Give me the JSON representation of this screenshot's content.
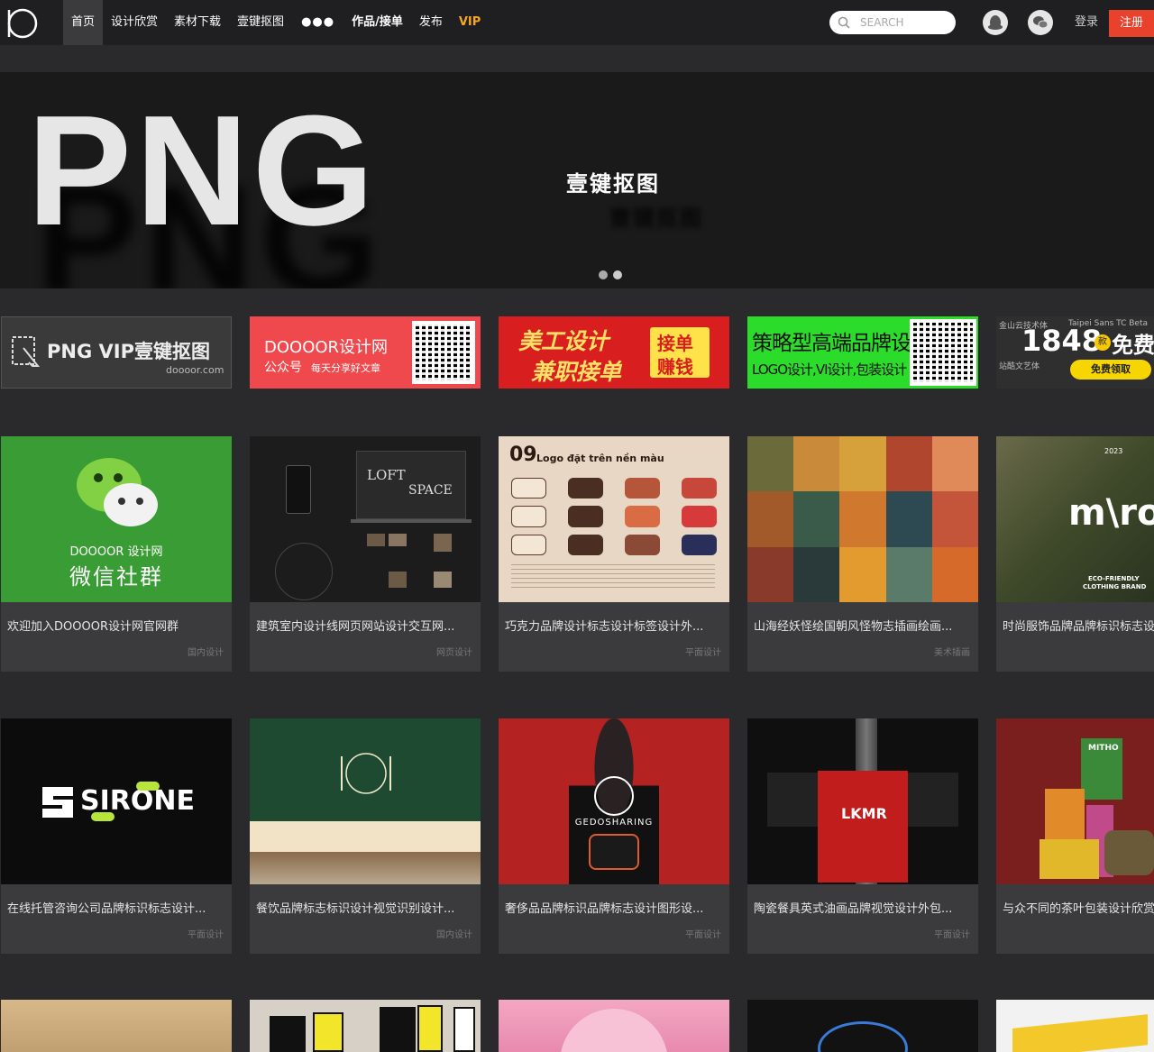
{
  "nav": {
    "items": [
      {
        "label": "首页",
        "active": true
      },
      {
        "label": "设计欣赏"
      },
      {
        "label": "素材下载"
      },
      {
        "label": "壹键抠图"
      },
      {
        "label": "●●●"
      },
      {
        "label": "作品/接单"
      },
      {
        "label": "发布"
      },
      {
        "label": "VIP",
        "vip": true
      }
    ],
    "search_placeholder": "SEARCH",
    "login": "登录",
    "register": "注册"
  },
  "hero": {
    "big_text": "PNG",
    "subtitle": "壹键抠图"
  },
  "banners": {
    "b1": {
      "big": "PNG  VIP壹键抠图",
      "url": "doooor.com"
    },
    "b2": {
      "title": "DOOOOR设计网",
      "sub1": "公众号",
      "sub2": "每天分享好文章"
    },
    "b3": {
      "line1": "美工设计",
      "line2": "兼职接单",
      "tag1": "接单",
      "tag2": "赚钱"
    },
    "b4": {
      "line1": "策略型高端品牌设计",
      "line2": "LOGO设计,VI设计,包装设计"
    },
    "b5": {
      "number": "1848",
      "badge": "款",
      "free": "免费",
      "button": "免费领取",
      "font1": "金山云技术体",
      "font2": "Taipei Sans TC Beta",
      "font3": "站酷文艺体"
    }
  },
  "cards": [
    {
      "title": "欢迎加入DOOOOR设计网官网群",
      "tag": "国内设计",
      "thumb": {
        "kind": "wechat",
        "t1": "DOOOOR 设计网",
        "t2": "微信社群"
      }
    },
    {
      "title": "建筑室内设计线网页网站设计交互网...",
      "tag": "网页设计",
      "thumb": {
        "kind": "loft",
        "t1": "LOFT",
        "t2": "SPACE"
      }
    },
    {
      "title": "巧克力品牌设计标志设计标签设计外...",
      "tag": "平面设计",
      "thumb": {
        "kind": "oreo",
        "t1": "09",
        "t2": "Logo đặt trên nền màu"
      }
    },
    {
      "title": "山海经妖怪绘国朝风怪物志插画绘画...",
      "tag": "美术插画",
      "thumb": {
        "kind": "art"
      }
    },
    {
      "title": "时尚服饰品牌品牌标识标志设计",
      "tag": "",
      "thumb": {
        "kind": "miro",
        "t1": "m\\ro",
        "t2": "ECO-FRIENDLY",
        "t3": "CLOTHING BRAND",
        "t4": "2023"
      }
    },
    {
      "title": "在线托管咨询公司品牌标识标志设计...",
      "tag": "平面设计",
      "thumb": {
        "kind": "sirone",
        "t1": "SIRONE"
      }
    },
    {
      "title": "餐饮品牌标志标识设计视觉识别设计...",
      "tag": "国内设计",
      "thumb": {
        "kind": "resto"
      }
    },
    {
      "title": "奢侈品品牌标识品牌标志设计图形设...",
      "tag": "平面设计",
      "thumb": {
        "kind": "gedo",
        "t1": "GEDOSHARING"
      }
    },
    {
      "title": "陶瓷餐具英式油画品牌视觉设计外包...",
      "tag": "平面设计",
      "thumb": {
        "kind": "lkmr",
        "t1": "LKMR"
      }
    },
    {
      "title": "与众不同的茶叶包装设计欣赏",
      "tag": "",
      "thumb": {
        "kind": "tea",
        "t1": "MITHO"
      }
    }
  ],
  "colors": {
    "accent": "#e8412c",
    "vip": "#f5a623",
    "card_bg": "#3b3b3e",
    "page_bg": "#2a2a2c"
  }
}
